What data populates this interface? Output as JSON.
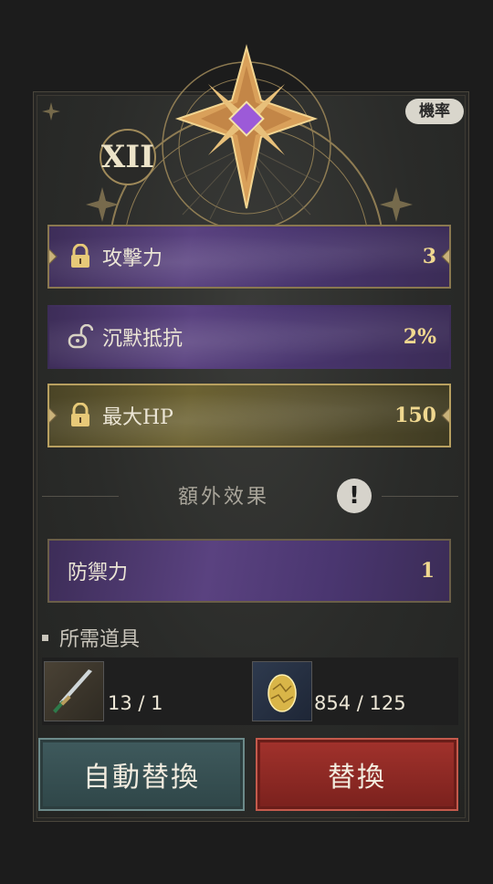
{
  "header": {
    "rank_numeral": "XII",
    "rate_badge": "機率"
  },
  "stats": [
    {
      "name": "攻擊力",
      "value": "3",
      "lock": "locked",
      "style": "purple"
    },
    {
      "name": "沉默抵抗",
      "value": "2%",
      "lock": "unlocked",
      "style": "purple"
    },
    {
      "name": "最大HP",
      "value": "150",
      "lock": "locked",
      "style": "gold"
    }
  ],
  "extra_section": {
    "title": "額外效果",
    "alert_symbol": "!",
    "effect": {
      "name": "防禦力",
      "value": "1"
    }
  },
  "requirements": {
    "title": "所需道具",
    "items": [
      {
        "icon": "dagger-icon",
        "count": "13 / 1"
      },
      {
        "icon": "gold-egg-icon",
        "count": "854 / 125"
      }
    ]
  },
  "buttons": {
    "auto_replace": "自動替換",
    "replace": "替換"
  },
  "colors": {
    "purple_bar": "#4a3670",
    "gold_bar": "#6c6232",
    "value_text": "#f0d890",
    "auto_button": "#3f5a5d",
    "replace_button": "#a2322c"
  }
}
